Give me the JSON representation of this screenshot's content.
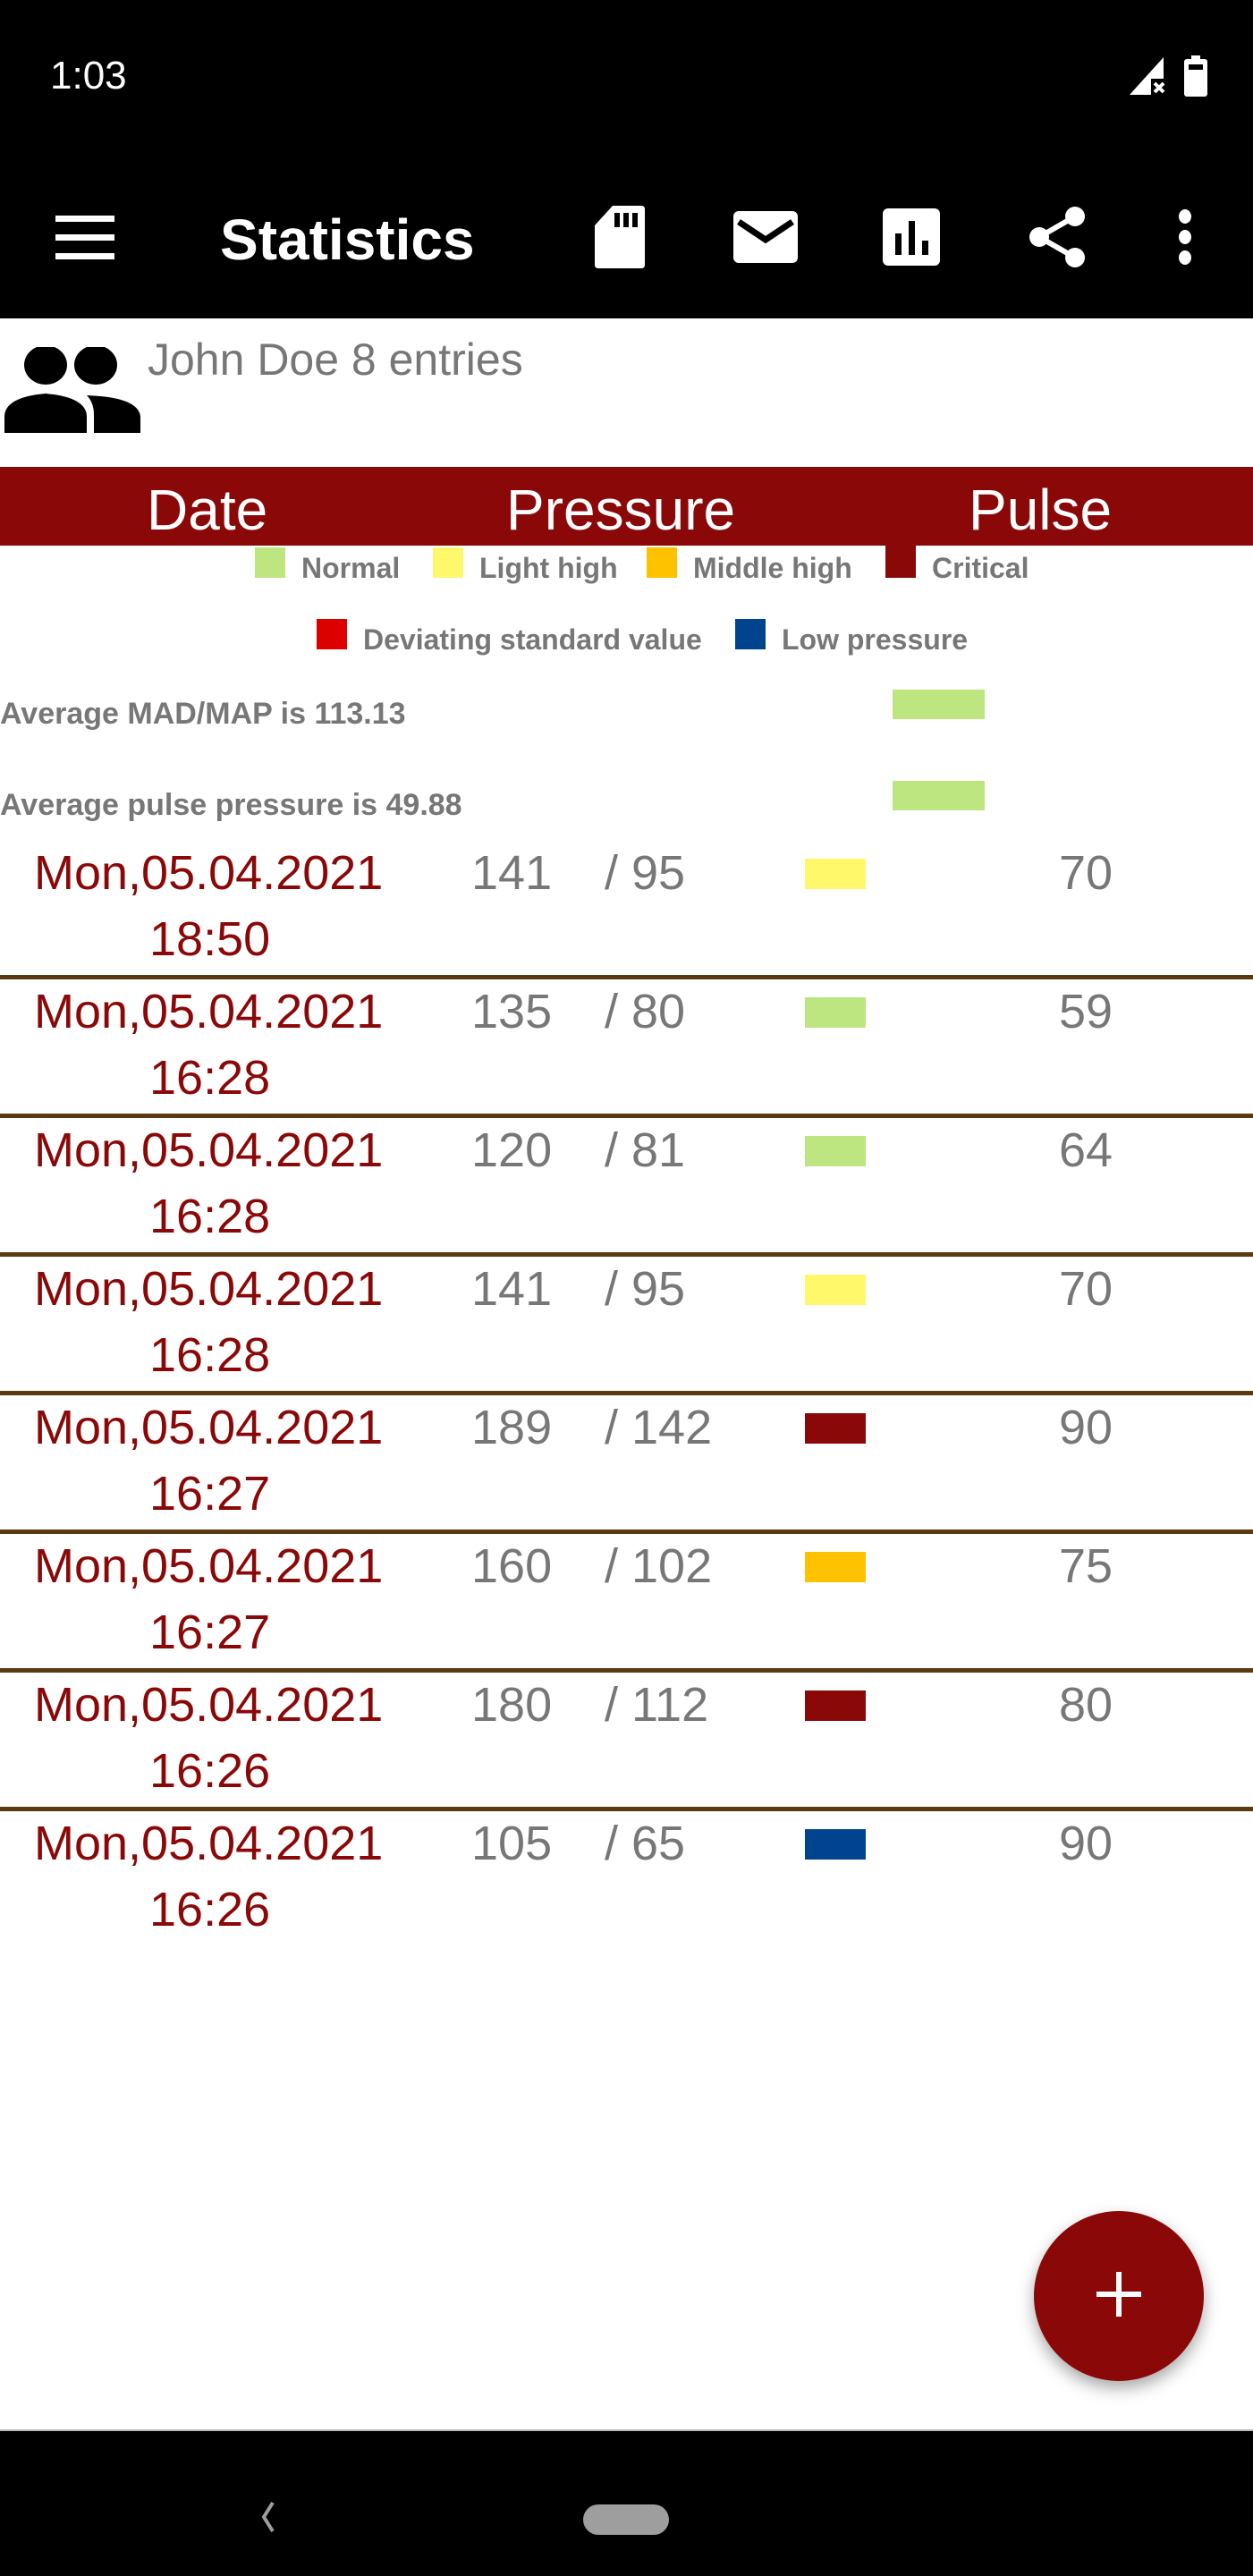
{
  "status_bar": {
    "time": "1:03",
    "icons": [
      "signal-no-sim-icon",
      "battery-icon"
    ]
  },
  "toolbar": {
    "title": "Statistics",
    "menu_icon": "hamburger-menu-icon",
    "actions": [
      {
        "name": "sd-card-icon",
        "label": "Save to SD card"
      },
      {
        "name": "mail-icon",
        "label": "Send mail"
      },
      {
        "name": "bar-chart-icon",
        "label": "Chart"
      },
      {
        "name": "share-icon",
        "label": "Share"
      },
      {
        "name": "more-vert-icon",
        "label": "More options"
      }
    ]
  },
  "user": {
    "icon": "people-icon",
    "text": "John Doe 8 entries"
  },
  "table_header": {
    "date": "Date",
    "pressure": "Pressure",
    "pulse": "Pulse"
  },
  "legend": [
    {
      "label": "Normal",
      "color": "#bde681"
    },
    {
      "label": "Light high",
      "color": "#fff86a"
    },
    {
      "label": "Middle high",
      "color": "#ffc200"
    },
    {
      "label": "Critical",
      "color": "#8b0808"
    },
    {
      "label": "Deviating standard value",
      "color": "#dd0000"
    },
    {
      "label": "Low pressure",
      "color": "#00448f"
    }
  ],
  "averages": [
    {
      "text": "Average MAD/MAP is 113.13",
      "color": "#bde681"
    },
    {
      "text": "Average pulse pressure is 49.88",
      "color": "#bde681"
    }
  ],
  "entries": [
    {
      "date": "Mon,05.04.2021",
      "time": "18:50",
      "systolic": "141",
      "diastolic": "/ 95",
      "pulse": "70",
      "category": "Light high",
      "color": "#fff86a"
    },
    {
      "date": "Mon,05.04.2021",
      "time": "16:28",
      "systolic": "135",
      "diastolic": "/ 80",
      "pulse": "59",
      "category": "Normal",
      "color": "#bde681"
    },
    {
      "date": "Mon,05.04.2021",
      "time": "16:28",
      "systolic": "120",
      "diastolic": "/ 81",
      "pulse": "64",
      "category": "Normal",
      "color": "#bde681"
    },
    {
      "date": "Mon,05.04.2021",
      "time": "16:28",
      "systolic": "141",
      "diastolic": "/ 95",
      "pulse": "70",
      "category": "Light high",
      "color": "#fff86a"
    },
    {
      "date": "Mon,05.04.2021",
      "time": "16:27",
      "systolic": "189",
      "diastolic": "/ 142",
      "pulse": "90",
      "category": "Critical",
      "color": "#8b0808"
    },
    {
      "date": "Mon,05.04.2021",
      "time": "16:27",
      "systolic": "160",
      "diastolic": "/ 102",
      "pulse": "75",
      "category": "Middle high",
      "color": "#ffc200"
    },
    {
      "date": "Mon,05.04.2021",
      "time": "16:26",
      "systolic": "180",
      "diastolic": "/ 112",
      "pulse": "80",
      "category": "Critical",
      "color": "#8b0808"
    },
    {
      "date": "Mon,05.04.2021",
      "time": "16:26",
      "systolic": "105",
      "diastolic": "/ 65",
      "pulse": "90",
      "category": "Low pressure",
      "color": "#00448f"
    }
  ],
  "fab": {
    "icon": "add-icon",
    "label": "Add entry"
  },
  "nav_bar": {
    "back_icon": "back-icon",
    "home_icon": "home-pill-icon"
  },
  "colors": {
    "accent": "#8b0808",
    "divider": "#5a3a10",
    "text_gray": "#777777"
  }
}
